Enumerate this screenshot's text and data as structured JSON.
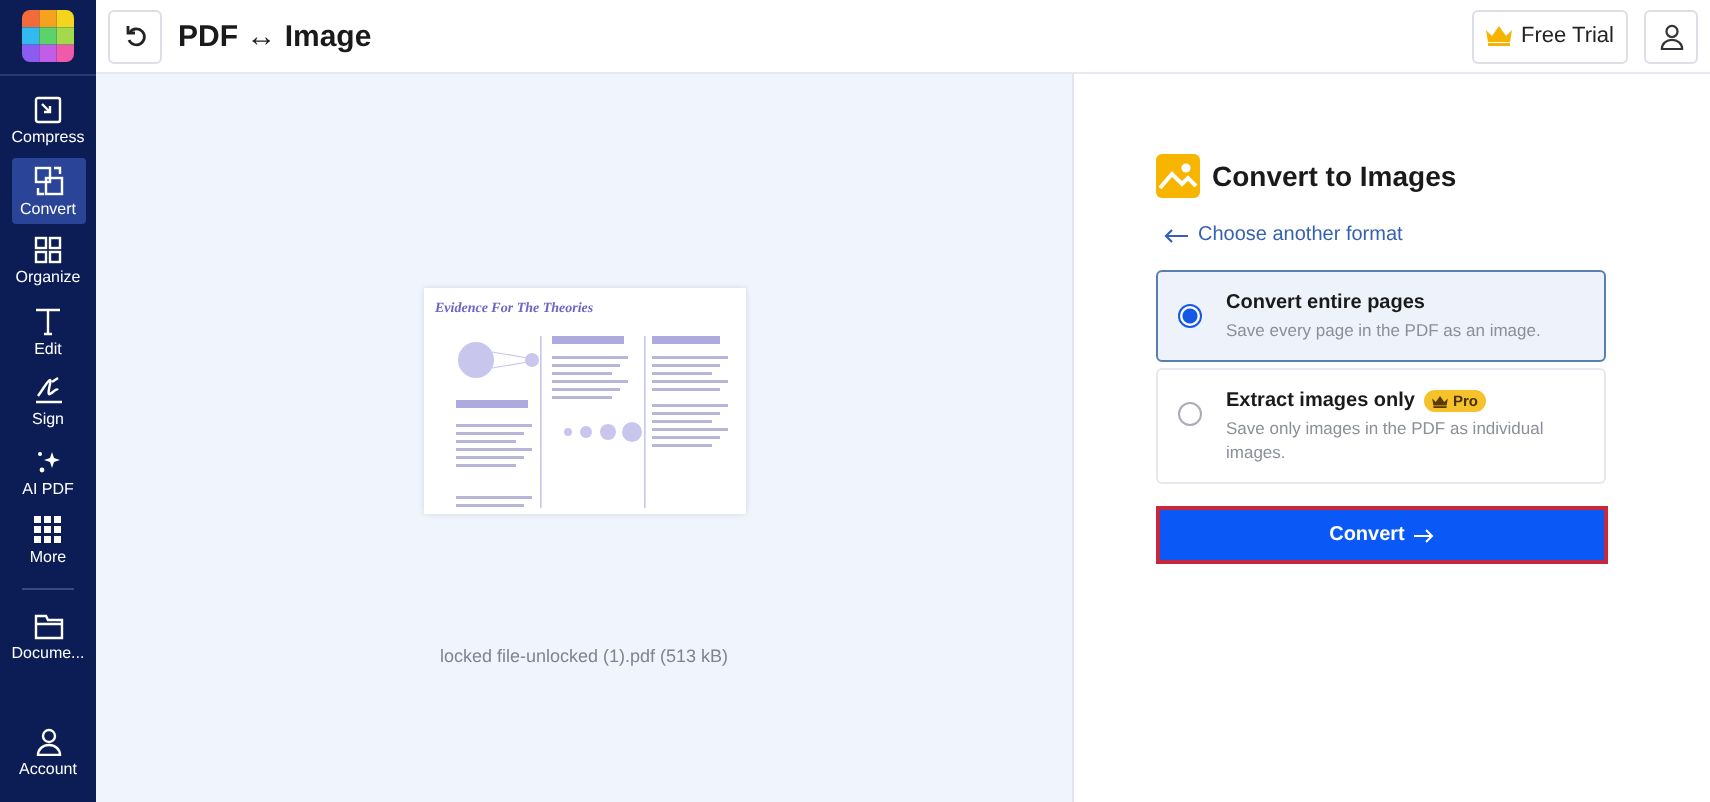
{
  "sidebar": {
    "items": [
      {
        "label": "Compress",
        "selected": false
      },
      {
        "label": "Convert",
        "selected": true
      },
      {
        "label": "Organize",
        "selected": false
      },
      {
        "label": "Edit",
        "selected": false
      },
      {
        "label": "Sign",
        "selected": false
      },
      {
        "label": "AI PDF",
        "selected": false
      },
      {
        "label": "More",
        "selected": false
      }
    ],
    "bottom_items": [
      {
        "label": "Docume...",
        "selected": false
      }
    ],
    "account": {
      "label": "Account"
    }
  },
  "topbar": {
    "title": "PDF ↔ Image",
    "trial_button": "Free Trial"
  },
  "preview": {
    "document_title": "Evidence For The Theories",
    "file_caption": "locked file-unlocked (1).pdf (513 kB)"
  },
  "panel": {
    "heading": "Convert to Images",
    "back_link": "Choose another format",
    "options": [
      {
        "title": "Convert entire pages",
        "description": "Save every page in the PDF as an image.",
        "selected": true
      },
      {
        "title": "Extract images only",
        "badge": "Pro",
        "description": "Save only images in the PDF as individual images.",
        "selected": false
      }
    ],
    "convert_button": "Convert"
  }
}
